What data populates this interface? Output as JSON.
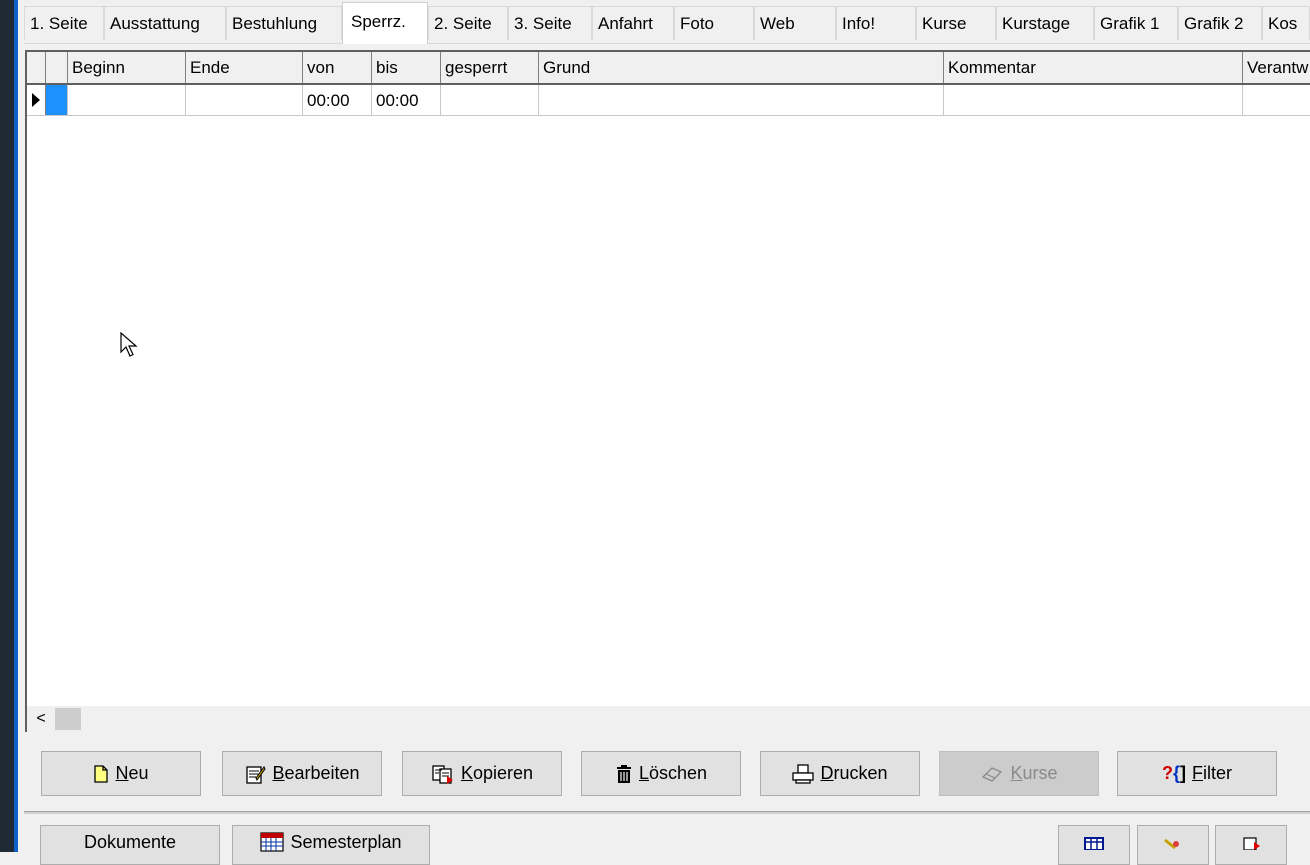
{
  "tabs": [
    {
      "label": "1. Seite",
      "active": false
    },
    {
      "label": "Ausstattung",
      "active": false
    },
    {
      "label": "Bestuhlung",
      "active": false
    },
    {
      "label": "Sperrz.",
      "active": true
    },
    {
      "label": "2. Seite",
      "active": false
    },
    {
      "label": "3. Seite",
      "active": false
    },
    {
      "label": "Anfahrt",
      "active": false
    },
    {
      "label": "Foto",
      "active": false
    },
    {
      "label": "Web",
      "active": false
    },
    {
      "label": "Info!",
      "active": false
    },
    {
      "label": "Kurse",
      "active": false
    },
    {
      "label": "Kurstage",
      "active": false
    },
    {
      "label": "Grafik 1",
      "active": false
    },
    {
      "label": "Grafik 2",
      "active": false
    },
    {
      "label": "Kos",
      "active": false
    }
  ],
  "grid": {
    "columns": [
      "Beginn",
      "Ende",
      "von",
      "bis",
      "gesperrt",
      "Grund",
      "Kommentar",
      "Verantw"
    ],
    "rows": [
      {
        "beginn": "",
        "ende": "",
        "von": "00:00",
        "bis": "00:00",
        "gesperrt": "",
        "grund": "",
        "kommentar": "",
        "verantw": ""
      }
    ],
    "scroll_left_glyph": "<"
  },
  "actions": {
    "neu": {
      "label_u": "N",
      "label_rest": "eu",
      "icon": "new-document-icon"
    },
    "bearbeiten": {
      "label_u": "B",
      "label_rest": "earbeiten",
      "icon": "edit-document-icon"
    },
    "kopieren": {
      "label_u": "K",
      "label_rest": "opieren",
      "icon": "copy-icon"
    },
    "loeschen": {
      "label_u": "L",
      "label_rest": "öschen",
      "icon": "trash-icon"
    },
    "drucken": {
      "label_u": "D",
      "label_rest": "rucken",
      "icon": "printer-icon"
    },
    "kurse": {
      "label_u": "K",
      "label_rest": "urse",
      "icon": "eraser-icon",
      "disabled": true
    },
    "filter": {
      "label_u": "F",
      "label_rest": "ilter",
      "icon": "filter-icon",
      "icon_text": "?{}"
    }
  },
  "bottom": {
    "dokumente": "Dokumente",
    "semesterplan": "Semesterplan"
  },
  "colors": {
    "selection": "#1e90ff",
    "window_bg": "#f0f0f0"
  }
}
